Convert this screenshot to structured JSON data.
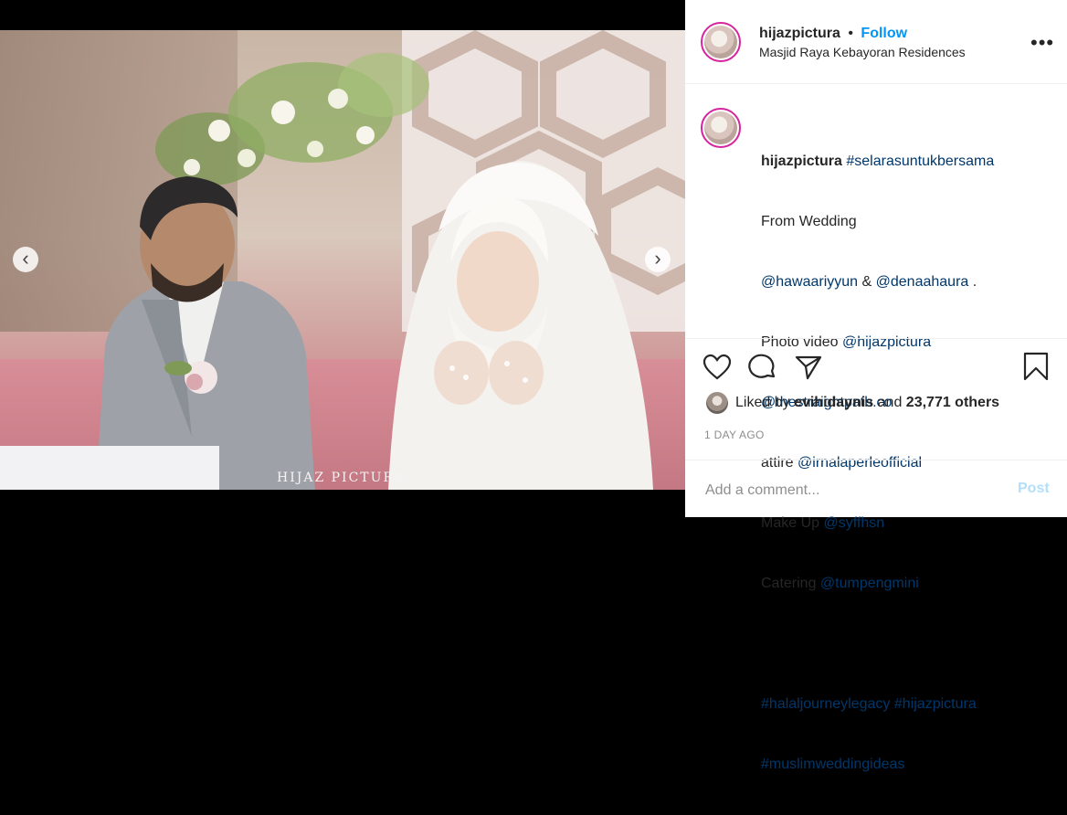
{
  "post": {
    "username": "hijazpictura",
    "separator": "•",
    "follow_label": "Follow",
    "location": "Masjid Raya Kebayoran Residences",
    "more_label": "•••",
    "watermark": "HIJAZ PICTURA"
  },
  "caption": {
    "username": "hijazpictura",
    "lines": [
      {
        "tag": "#selarasuntukbersama",
        "text": ""
      },
      {
        "text": "From Wedding"
      },
      {
        "tag": "@hawaariyyun",
        "text": " & ",
        "tag2": "@denaahaura",
        "text2": " ."
      },
      {
        "text": "Photo video ",
        "tag": "@hijazpictura"
      },
      {
        "tag": "@thestraightpath.co"
      },
      {
        "text": "attire ",
        "tag": "@irnalaperleofficial"
      },
      {
        "text": "Make Up ",
        "tag": "@syffhsn"
      },
      {
        "text": "Catering ",
        "tag": "@tumpengmini"
      },
      {
        "text": ""
      },
      {
        "tag": "#halaljourneylegacy",
        "text": " ",
        "tag2": "#hijazpictura"
      },
      {
        "tag": "#muslimweddingideas"
      }
    ]
  },
  "likes": {
    "prefix": "Liked by ",
    "user": "evihidaynis",
    "middle": " and ",
    "count": "23,771 others"
  },
  "time_ago": "1 DAY AGO",
  "comment": {
    "placeholder": "Add a comment...",
    "post_label": "Post"
  },
  "carousel": {
    "prev_label": "‹",
    "next_label": "›",
    "total_dots": 5,
    "active_dot": 3
  },
  "colors": {
    "link": "#00376b",
    "follow": "#0095f6",
    "post_disabled": "#b2dffc",
    "active_dot": "#3897f0"
  },
  "icons": [
    "heart-icon",
    "comment-icon",
    "share-icon",
    "bookmark-icon",
    "more-options-icon"
  ]
}
